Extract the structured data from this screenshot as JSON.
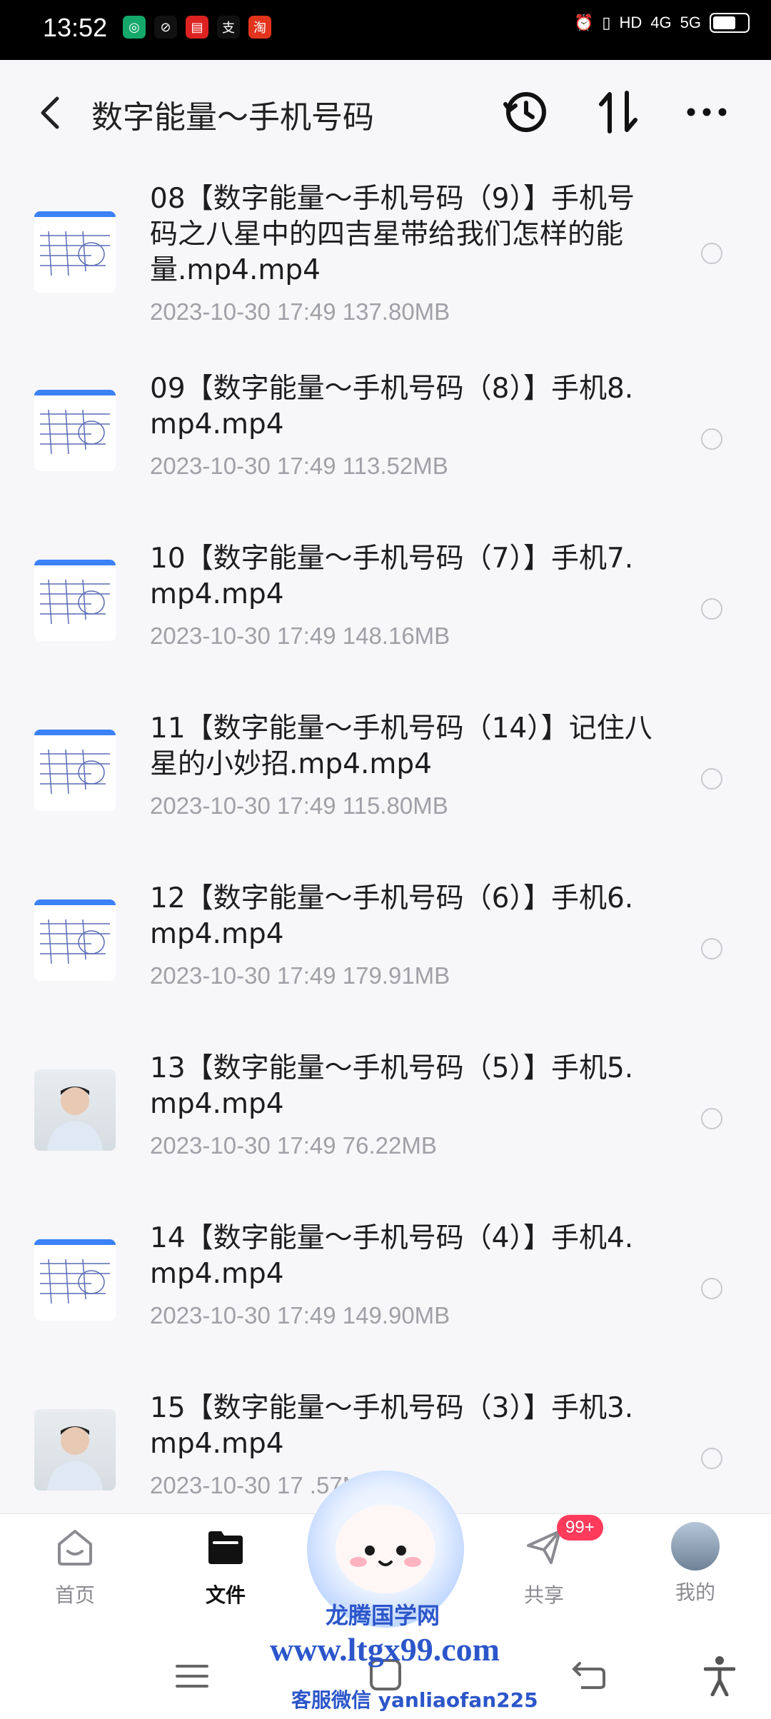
{
  "status_bar": {
    "time": "13:52",
    "right_text": [
      "HD",
      "4G",
      "5G"
    ]
  },
  "header": {
    "title": "数字能量～手机号码"
  },
  "files": [
    {
      "name": "08【数字能量～手机号码（9）】手机号码之八星中的四吉星带给我们怎样的能量.mp4.mp4",
      "date": "2023-10-30",
      "time": "17:49",
      "size": "137.80MB",
      "thumb": "doc"
    },
    {
      "name": "09【数字能量～手机号码（8）】手机8.mp4.mp4",
      "date": "2023-10-30",
      "time": "17:49",
      "size": "113.52MB",
      "thumb": "doc"
    },
    {
      "name": "10【数字能量～手机号码（7）】手机7.mp4.mp4",
      "date": "2023-10-30",
      "time": "17:49",
      "size": "148.16MB",
      "thumb": "doc"
    },
    {
      "name": "11【数字能量～手机号码（14）】记住八星的小妙招.mp4.mp4",
      "date": "2023-10-30",
      "time": "17:49",
      "size": "115.80MB",
      "thumb": "doc"
    },
    {
      "name": "12【数字能量～手机号码（6）】手机6.mp4.mp4",
      "date": "2023-10-30",
      "time": "17:49",
      "size": "179.91MB",
      "thumb": "doc"
    },
    {
      "name": "13【数字能量～手机号码（5）】手机5.mp4.mp4",
      "date": "2023-10-30",
      "time": "17:49",
      "size": "76.22MB",
      "thumb": "person"
    },
    {
      "name": "14【数字能量～手机号码（4）】手机4.mp4.mp4",
      "date": "2023-10-30",
      "time": "17:49",
      "size": "149.90MB",
      "thumb": "doc"
    },
    {
      "name": "15【数字能量～手机号码（3）】手机3.mp4.mp4",
      "date": "2023-10-30",
      "time": "17",
      "size": ".57MB",
      "thumb": "person"
    }
  ],
  "tabs": [
    {
      "label": "首页",
      "icon": "home-icon"
    },
    {
      "label": "文件",
      "icon": "folder-icon",
      "active": true
    },
    {
      "label": "共享",
      "icon": "send-icon",
      "badge": "99+"
    },
    {
      "label": "我的",
      "icon": "avatar"
    }
  ],
  "watermark": {
    "line1": "龙腾国学网",
    "line2": "www.ltgx99.com",
    "line3": "客服微信 yanliaofan225"
  },
  "colors": {
    "accent": "#3b82f6",
    "badge": "#ff3b5c",
    "watermark": "#2c56c9"
  }
}
